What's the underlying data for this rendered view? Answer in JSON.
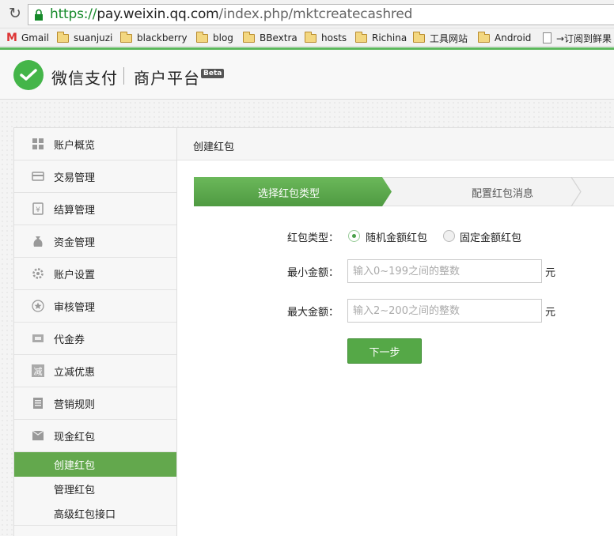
{
  "browser": {
    "reload_icon": "reload-icon",
    "url_protocol": "https://",
    "url_host": "pay.weixin.qq.com",
    "url_path": "/index.php/mktcreatecashred",
    "bookmarks": [
      "Gmail",
      "suanjuzi",
      "blackberry",
      "blog",
      "BBextra",
      "hosts",
      "Richina",
      "工具网站",
      "Android",
      "→订阅到鲜果"
    ]
  },
  "header": {
    "brand": "微信支付",
    "platform": "商户平台",
    "badge": "Beta",
    "accent_color": "#44b549"
  },
  "sidebar": {
    "items": [
      {
        "label": "账户概览",
        "icon": "dashboard-icon"
      },
      {
        "label": "交易管理",
        "icon": "transaction-icon"
      },
      {
        "label": "结算管理",
        "icon": "settlement-icon"
      },
      {
        "label": "资金管理",
        "icon": "money-bag-icon"
      },
      {
        "label": "账户设置",
        "icon": "gear-icon"
      },
      {
        "label": "审核管理",
        "icon": "star-icon"
      },
      {
        "label": "代金券",
        "icon": "voucher-icon"
      },
      {
        "label": "立减优惠",
        "icon": "discount-icon"
      },
      {
        "label": "营销规则",
        "icon": "rules-icon"
      },
      {
        "label": "现金红包",
        "icon": "red-packet-icon"
      }
    ],
    "subitems": [
      {
        "label": "创建红包",
        "active": true
      },
      {
        "label": "管理红包",
        "active": false
      },
      {
        "label": "高级红包接口",
        "active": false
      }
    ]
  },
  "main": {
    "title": "创建红包",
    "steps": [
      "选择红包类型",
      "配置红包消息"
    ],
    "form": {
      "type_label": "红包类型：",
      "type_options": [
        {
          "label": "随机金额红包",
          "selected": true
        },
        {
          "label": "固定金额红包",
          "selected": false
        }
      ],
      "min_label": "最小金额：",
      "min_placeholder": "输入0~199之间的整数",
      "max_label": "最大金额：",
      "max_placeholder": "输入2~200之间的整数",
      "unit": "元",
      "next_button": "下一步"
    }
  }
}
